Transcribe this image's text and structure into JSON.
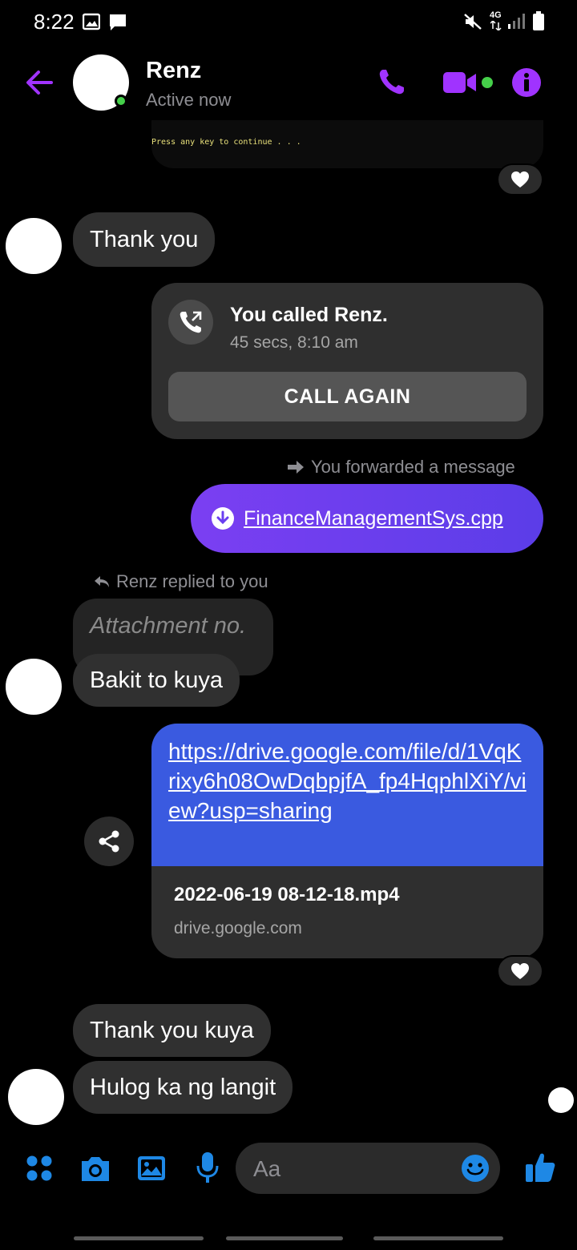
{
  "status_bar": {
    "time": "8:22",
    "network": "4G",
    "icons": [
      "gallery-icon",
      "message-icon",
      "mute-icon",
      "signal-icon",
      "battery-icon"
    ]
  },
  "header": {
    "contact_name": "Renz",
    "contact_status": "Active now",
    "icons": [
      "back-arrow-icon",
      "phone-icon",
      "video-icon",
      "info-icon"
    ],
    "accent_color": "#a033ff"
  },
  "conversation": {
    "terminal_snippet": "Press any key to continue . . .",
    "messages": {
      "thank_you": "Thank you",
      "call_title": "You called Renz.",
      "call_subtitle": "45 secs, 8:10 am",
      "call_again": "CALL AGAIN",
      "forwarded_note": "You forwarded a message",
      "file_name": "FinanceManagementSys.cpp",
      "reply_note": "Renz replied to you",
      "reply_quote": "Attachment no.",
      "bakit": "Bakit to kuya",
      "link_url": "https://drive.google.com/file/d/1VqKrixy6h08OwDqbpjfA_fp4HqphlXiY/view?usp=sharing",
      "link_file": "2022-06-19 08-12-18.mp4",
      "link_domain": "drive.google.com",
      "thank_you_kuya": "Thank you kuya",
      "hulog": "Hulog ka ng langit"
    },
    "colors": {
      "incoming_bubble": "#303030",
      "outgoing_gradient_start": "#7b3ff2",
      "outgoing_gradient_end": "#5b3de8",
      "link_preview": "#3a5ae0"
    }
  },
  "composer": {
    "placeholder": "Aa",
    "icons": [
      "menu-grid-icon",
      "camera-icon",
      "gallery-icon",
      "microphone-icon",
      "emoji-icon",
      "like-icon"
    ],
    "accent_color": "#1e88e5"
  }
}
